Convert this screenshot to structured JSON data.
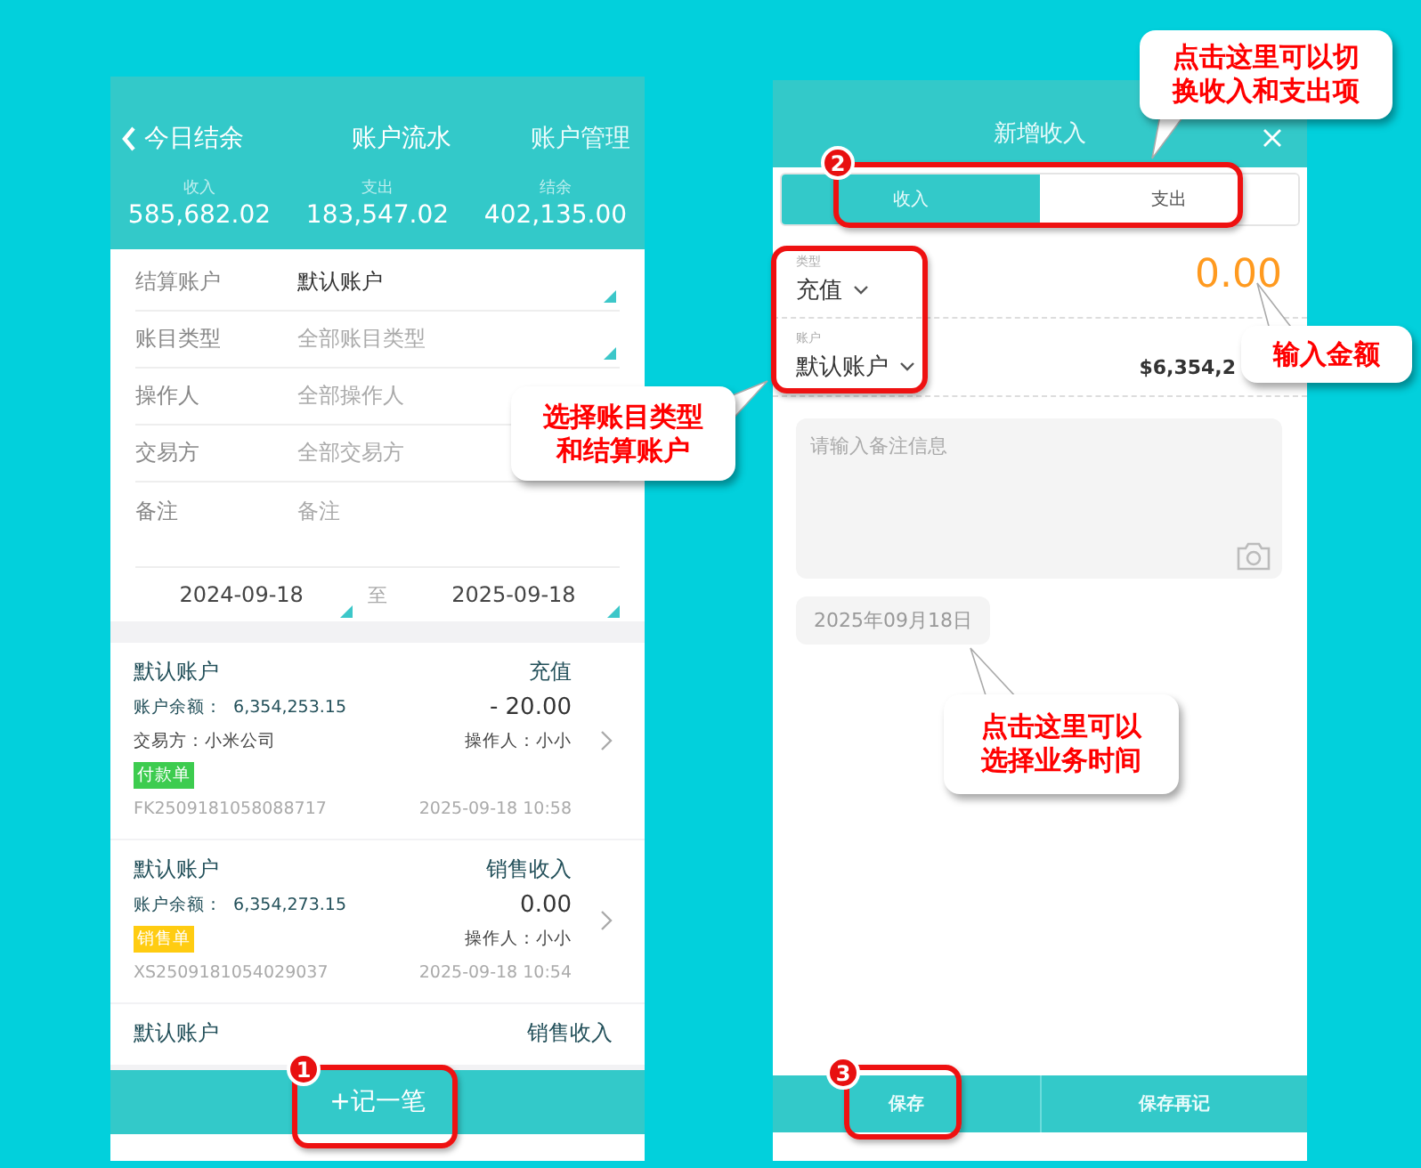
{
  "left_screen": {
    "header": {
      "back": "今日结余",
      "title": "账户流水",
      "action": "账户管理"
    },
    "summary": [
      {
        "label": "收入",
        "value": "585,682.02"
      },
      {
        "label": "支出",
        "value": "183,547.02"
      },
      {
        "label": "结余",
        "value": "402,135.00"
      }
    ],
    "filters": [
      {
        "label": "结算账户",
        "value": "默认账户",
        "dropdown": true
      },
      {
        "label": "账目类型",
        "placeholder": "全部账目类型",
        "dropdown": true
      },
      {
        "label": "操作人",
        "placeholder": "全部操作人"
      },
      {
        "label": "交易方",
        "placeholder": "全部交易方"
      },
      {
        "label": "备注",
        "placeholder": "备注",
        "dropdown": false
      }
    ],
    "date_range": {
      "start": "2024-09-18",
      "separator": "至",
      "end": "2025-09-18"
    },
    "records": [
      {
        "account": "默认账户",
        "category": "充值",
        "balance_label": "账户余额：",
        "balance": "6,354,253.15",
        "amount": "- 20.00",
        "counterparty": "交易方：小米公司",
        "operator": "操作人：小小",
        "tag": {
          "text": "付款单",
          "color": "#3dcc4f"
        },
        "number": "FK2509181058088717",
        "time": "2025-09-18 10:58"
      },
      {
        "account": "默认账户",
        "category": "销售收入",
        "balance_label": "账户余额：",
        "balance": "6,354,273.15",
        "amount": "0.00",
        "operator": "操作人：小小",
        "tag": {
          "text": "销售单",
          "color": "#ffcc11"
        },
        "number": "XS2509181054029037",
        "time": "2025-09-18 10:54"
      },
      {
        "account": "默认账户",
        "category": "销售收入"
      }
    ],
    "add_button": "+记一笔"
  },
  "right_screen": {
    "title": "新增收入",
    "tabs": [
      {
        "label": "收入",
        "selected": true
      },
      {
        "label": "支出",
        "selected": false
      }
    ],
    "type_field": {
      "label": "类型",
      "value": "充值"
    },
    "account_field": {
      "label": "账户",
      "value": "默认账户"
    },
    "amount": "0.00",
    "balance": "$6,354,2",
    "note": {
      "placeholder": "请输入备注信息"
    },
    "date": "2025年09月18日",
    "buttons": [
      "保存",
      "保存再记"
    ]
  },
  "annotations": {
    "callouts": [
      {
        "lines": [
          "点击这里可以切",
          "换收入和支出项"
        ]
      },
      {
        "lines": [
          "输入金额"
        ]
      },
      {
        "lines": [
          "选择账目类型",
          "和结算账户"
        ]
      },
      {
        "lines": [
          "点击这里可以",
          "选择业务时间"
        ]
      }
    ],
    "markers": [
      "1",
      "2",
      "3"
    ]
  }
}
